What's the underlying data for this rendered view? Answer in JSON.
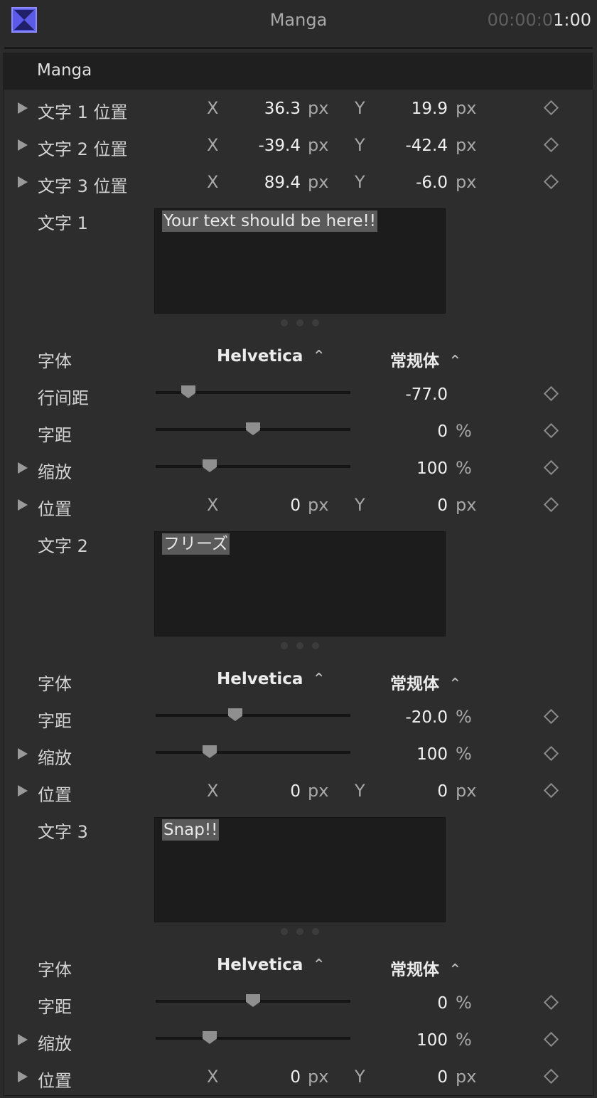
{
  "window": {
    "title": "Manga",
    "timecode_dim": "00:00:0",
    "timecode_bright": "1:00"
  },
  "header": {
    "title": "Manga"
  },
  "positions": [
    {
      "label": "文字 1 位置",
      "x_axis": "X",
      "x": "36.3",
      "x_unit": "px",
      "y_axis": "Y",
      "y": "19.9",
      "y_unit": "px"
    },
    {
      "label": "文字 2 位置",
      "x_axis": "X",
      "x": "-39.4",
      "x_unit": "px",
      "y_axis": "Y",
      "y": "-42.4",
      "y_unit": "px"
    },
    {
      "label": "文字 3 位置",
      "x_axis": "X",
      "x": "89.4",
      "x_unit": "px",
      "y_axis": "Y",
      "y": "-6.0",
      "y_unit": "px"
    }
  ],
  "text1": {
    "label": "文字 1",
    "content": "Your text should be here!!",
    "font_label": "字体",
    "font_family": "Helvetica",
    "font_style": "常规体",
    "line_spacing": {
      "label": "行间距",
      "value": "-77.0",
      "unit": "",
      "level": 0.14
    },
    "tracking": {
      "label": "字距",
      "value": "0",
      "unit": "%",
      "level": 0.5
    },
    "scale": {
      "label": "缩放",
      "value": "100",
      "unit": "%",
      "level": 0.26
    },
    "position": {
      "label": "位置",
      "x_axis": "X",
      "x": "0",
      "x_unit": "px",
      "y_axis": "Y",
      "y": "0",
      "y_unit": "px"
    }
  },
  "text2": {
    "label": "文字 2",
    "content": "フリーズ",
    "font_label": "字体",
    "font_family": "Helvetica",
    "font_style": "常规体",
    "tracking": {
      "label": "字距",
      "value": "-20.0",
      "unit": "%",
      "level": 0.4
    },
    "scale": {
      "label": "缩放",
      "value": "100",
      "unit": "%",
      "level": 0.26
    },
    "position": {
      "label": "位置",
      "x_axis": "X",
      "x": "0",
      "x_unit": "px",
      "y_axis": "Y",
      "y": "0",
      "y_unit": "px"
    }
  },
  "text3": {
    "label": "文字 3",
    "content": "Snap!!",
    "font_label": "字体",
    "font_family": "Helvetica",
    "font_style": "常规体",
    "tracking": {
      "label": "字距",
      "value": "0",
      "unit": "%",
      "level": 0.5
    },
    "scale": {
      "label": "缩放",
      "value": "100",
      "unit": "%",
      "level": 0.26
    },
    "position": {
      "label": "位置",
      "x_axis": "X",
      "x": "0",
      "x_unit": "px",
      "y_axis": "Y",
      "y": "0",
      "y_unit": "px"
    }
  },
  "icons": {
    "app": "final-cut-icon",
    "disclosure": "disclosure-triangle-icon",
    "keyframe": "keyframe-diamond-icon",
    "popup": "up-down-chevron-icon",
    "resize": "resize-handle-icon"
  },
  "colors": {
    "app_icon": "#5b5be8",
    "background": "#2d2d2d",
    "textbox": "#1c1c1c"
  }
}
